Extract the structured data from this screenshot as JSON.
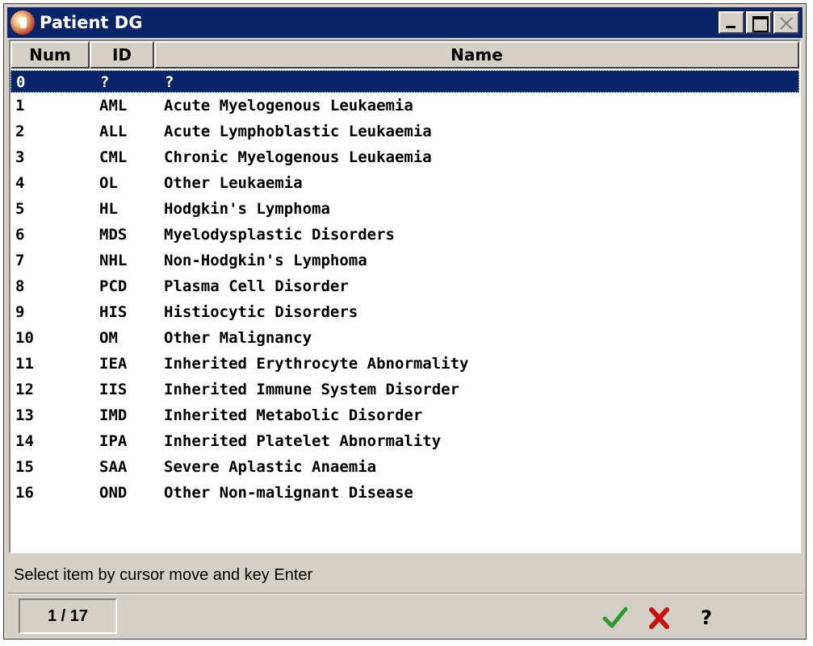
{
  "window": {
    "title": "Patient DG",
    "icon": "app-icon",
    "buttons": [
      "minimize-icon",
      "maximize-icon",
      "close-icon"
    ]
  },
  "table": {
    "headers": {
      "num": "Num",
      "id": "ID",
      "name": "Name"
    },
    "selected_index": 0,
    "rows": [
      {
        "num": "0",
        "id": "?",
        "name": "?"
      },
      {
        "num": "1",
        "id": "AML",
        "name": "Acute Myelogenous Leukaemia"
      },
      {
        "num": "2",
        "id": "ALL",
        "name": "Acute Lymphoblastic Leukaemia"
      },
      {
        "num": "3",
        "id": "CML",
        "name": "Chronic Myelogenous Leukaemia"
      },
      {
        "num": "4",
        "id": "OL",
        "name": "Other Leukaemia"
      },
      {
        "num": "5",
        "id": "HL",
        "name": "Hodgkin's Lymphoma"
      },
      {
        "num": "6",
        "id": "MDS",
        "name": "Myelodysplastic Disorders"
      },
      {
        "num": "7",
        "id": "NHL",
        "name": "Non-Hodgkin's Lymphoma"
      },
      {
        "num": "8",
        "id": "PCD",
        "name": "Plasma Cell Disorder"
      },
      {
        "num": "9",
        "id": "HIS",
        "name": "Histiocytic Disorders"
      },
      {
        "num": "10",
        "id": "OM",
        "name": "Other Malignancy"
      },
      {
        "num": "11",
        "id": "IEA",
        "name": "Inherited Erythrocyte Abnormality"
      },
      {
        "num": "12",
        "id": "IIS",
        "name": "Inherited Immune System Disorder"
      },
      {
        "num": "13",
        "id": "IMD",
        "name": "Inherited Metabolic Disorder"
      },
      {
        "num": "14",
        "id": "IPA",
        "name": "Inherited Platelet Abnormality"
      },
      {
        "num": "15",
        "id": "SAA",
        "name": "Severe Aplastic Anaemia"
      },
      {
        "num": "16",
        "id": "OND",
        "name": "Other Non-malignant Disease"
      }
    ]
  },
  "status": {
    "hint": "Select item by cursor move and key Enter",
    "counter": "1 / 17"
  },
  "actions": {
    "ok_icon": "checkmark-icon",
    "cancel_icon": "x-icon",
    "help_label": "?"
  },
  "colors": {
    "titlebar": "#0a246a",
    "selection": "#0a246a",
    "ok": "#2e9a2e",
    "cancel": "#c81010"
  }
}
